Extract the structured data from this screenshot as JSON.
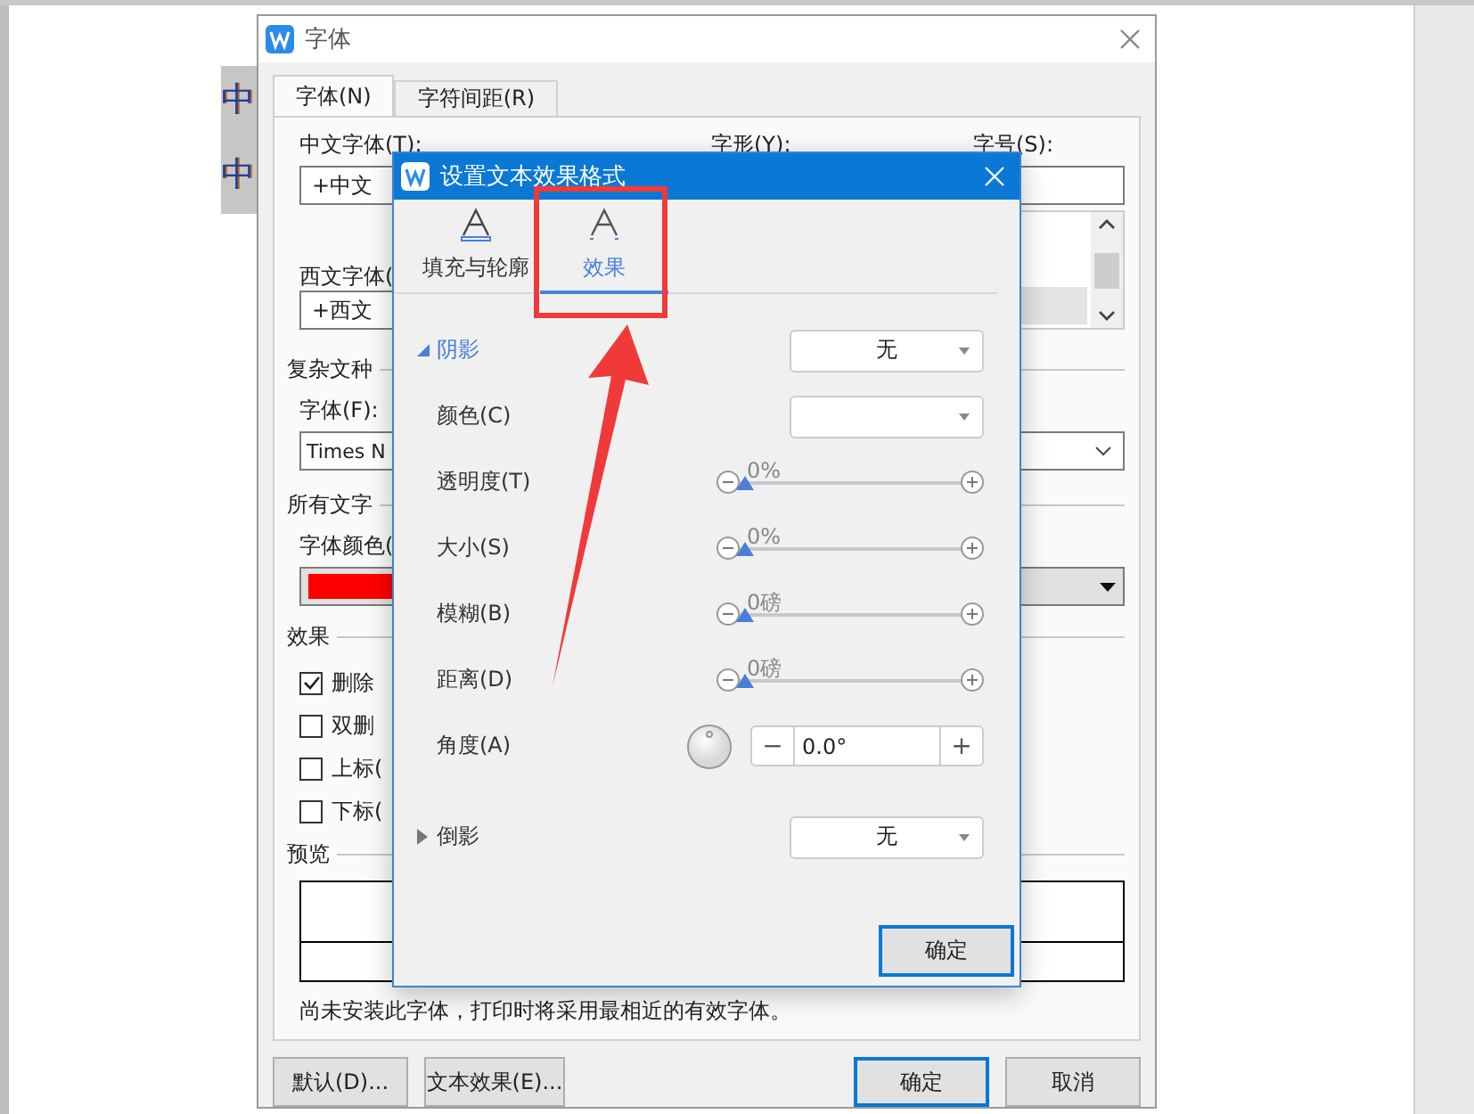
{
  "document": {
    "lines": [
      "中",
      "中"
    ]
  },
  "font_dialog": {
    "title": "字体",
    "tabs": [
      {
        "label": "字体(N)",
        "selected": true
      },
      {
        "label": "字符间距(R)",
        "selected": false
      }
    ],
    "chinese_font": {
      "label": "中文字体(T):",
      "value": "+中文"
    },
    "style_label": "字形(Y):",
    "size_label": "字号(S):",
    "western_font": {
      "label": "西文字体(",
      "value": "+西文"
    },
    "complex_section": "复杂文种",
    "complex_font": {
      "label": "字体(F):",
      "value": "Times N"
    },
    "all_text_section": "所有文字",
    "font_color": {
      "label": "字体颜色(",
      "color": "#ff0000"
    },
    "effects_section": "效果",
    "effects": [
      {
        "label": "删除",
        "checked": true
      },
      {
        "label": "双删",
        "checked": false
      },
      {
        "label": "上标(",
        "checked": false
      },
      {
        "label": "下标(",
        "checked": false
      }
    ],
    "preview_section": "预览",
    "note": "尚未安装此字体，打印时将采用最相近的有效字体。",
    "buttons": [
      {
        "label": "默认(D)...",
        "default": false
      },
      {
        "label": "文本效果(E)...",
        "default": false
      },
      {
        "label": "确定",
        "default": true
      },
      {
        "label": "取消",
        "default": false
      }
    ]
  },
  "effects_dialog": {
    "title": "设置文本效果格式",
    "tabs": [
      {
        "label": "填充与轮廓",
        "selected": false
      },
      {
        "label": "效果",
        "selected": true
      }
    ],
    "shadow": {
      "label": "阴影",
      "expanded": true,
      "value": "无"
    },
    "color_label": "颜色(C)",
    "sliders": [
      {
        "label": "透明度(T)",
        "reading": "0%",
        "level": 0
      },
      {
        "label": "大小(S)",
        "reading": "0%",
        "level": 0
      },
      {
        "label": "模糊(B)",
        "reading": "0磅",
        "level": 0
      },
      {
        "label": "距离(D)",
        "reading": "0磅",
        "level": 0
      }
    ],
    "angle": {
      "label": "角度(A)",
      "minus": "−",
      "value": "0.0°",
      "plus": "+"
    },
    "reflection": {
      "label": "倒影",
      "expanded": false,
      "value": "无"
    },
    "ok_button": {
      "label": "确定",
      "default": true
    }
  }
}
